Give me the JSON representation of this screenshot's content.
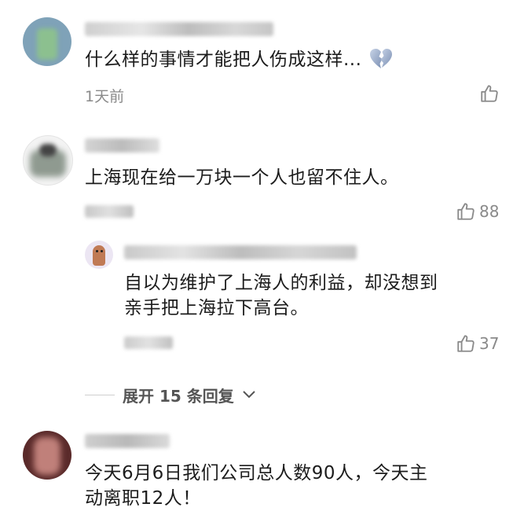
{
  "comments": [
    {
      "text": "什么样的事情才能把人伤成这样...",
      "time": "1天前",
      "like_count": "",
      "emoji": "broken-heart-icon"
    },
    {
      "text": "上海现在给一万块一个人也留不住人。",
      "like_count": "88",
      "reply": {
        "text_line1": "自以为维护了上海人的利益，却没想到",
        "text_line2": "亲手把上海拉下高台。",
        "like_count": "37"
      },
      "expand_label": "展开 15 条回复"
    },
    {
      "text_line1": "今天6月6日我们公司总人数90人，今天主",
      "text_line2": "动离职12人！"
    }
  ],
  "colors": {
    "text": "#1c1c1c",
    "meta": "#8a8a8a",
    "expand": "#555555",
    "background": "#ffffff"
  }
}
